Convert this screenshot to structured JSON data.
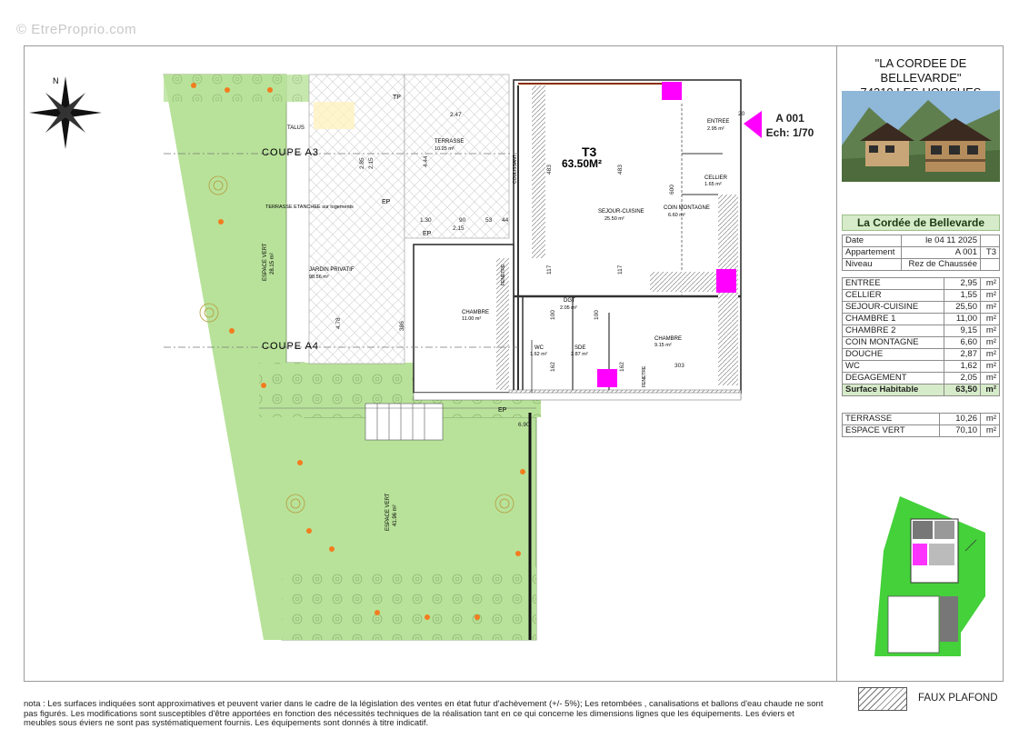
{
  "watermark": "© EtreProprio.com",
  "project": {
    "name": "\"LA CORDEE DE BELLEVARDE\"",
    "address": "74310 LES HOUCHES"
  },
  "residence_title": "La Cordée de Bellevarde",
  "unit": {
    "ref": "A 001",
    "scale": "Ech: 1/70"
  },
  "info": [
    {
      "label": "Date",
      "value": "le 04 11 2025",
      "extra": ""
    },
    {
      "label": "Appartement",
      "value": "A 001",
      "extra": "T3"
    },
    {
      "label": "Niveau",
      "value": "Rez de Chaussée",
      "extra": ""
    }
  ],
  "rooms": [
    {
      "name": "ENTREE",
      "area": "2,95",
      "unit": "m²"
    },
    {
      "name": "CELLIER",
      "area": "1,55",
      "unit": "m²"
    },
    {
      "name": "SEJOUR-CUISINE",
      "area": "25,50",
      "unit": "m²"
    },
    {
      "name": "CHAMBRE 1",
      "area": "11,00",
      "unit": "m²"
    },
    {
      "name": "CHAMBRE 2",
      "area": "9,15",
      "unit": "m²"
    },
    {
      "name": "COIN MONTAGNE",
      "area": "6,60",
      "unit": "m²"
    },
    {
      "name": "DOUCHE",
      "area": "2,87",
      "unit": "m²"
    },
    {
      "name": "WC",
      "area": "1,62",
      "unit": "m²"
    },
    {
      "name": "DEGAGEMENT",
      "area": "2,05",
      "unit": "m²"
    }
  ],
  "total": {
    "name": "Surface Habitable",
    "area": "63,50",
    "unit": "m²"
  },
  "exterior": [
    {
      "name": "TERRASSE",
      "area": "10,26",
      "unit": "m²"
    },
    {
      "name": "ESPACE VERT",
      "area": "70,10",
      "unit": "m²"
    }
  ],
  "plan": {
    "type": "T3",
    "surface": "63.50M²",
    "coupe_a3": "COUPE A3",
    "coupe_a4": "COUPE A4",
    "talus": "TALUS",
    "tp": "TP",
    "ep": "EP",
    "terrasse": "TERRASSE",
    "terrasse_area": "10.25 m²",
    "terrasse_note": "TERRASSE ETANCHEE sur logements",
    "jardin": "JARDIN PRIVATIF",
    "jardin_area": "98.56 m²",
    "espace_vert": "ESPACE VERT",
    "espace_vert_area_1": "28.15 m²",
    "espace_vert_area_2": "41.96 m²",
    "sejour": "SEJOUR-CUISINE",
    "sejour_area": "25.50 m²",
    "coin_montagne": "COIN MONTAGNE",
    "coin_montagne_area": "6.60 m²",
    "entree": "ENTREE",
    "entree_area": "2.95 m²",
    "cellier": "CELLIER",
    "cellier_area": "1.65 m²",
    "chambre1": "CHAMBRE",
    "chambre1_area": "11.00 m²",
    "chambre2": "CHAMBRE",
    "chambre2_area": "9.15 m²",
    "dgt": "DGT",
    "dgt_area": "2.05 m²",
    "wc": "WC",
    "wc_area": "1.62 m²",
    "sde": "SDE",
    "sde_area": "2.87 m²",
    "fenetre": "FENETRE",
    "coulissant": "COULISSANT",
    "dims": [
      "2.47",
      "4.44",
      "2.85",
      "2.15",
      "1.30",
      "90",
      "53",
      "44",
      "2.15",
      "483",
      "483",
      "600",
      "117",
      "117",
      "386",
      "4.78",
      "100",
      "100",
      "162",
      "162",
      "303",
      "6.90",
      "20"
    ]
  },
  "legend": {
    "label": "FAUX PLAFOND"
  },
  "note": "nota : Les surfaces indiquées sont approximatives et peuvent varier dans le cadre de la législation des ventes en état futur d'achèvement (+/- 5%); Les retombées , canalisations et ballons d'eau chaude ne sont pas figurés. Les modifications sont susceptibles d'être apportées en fonction des nécessités techniques de la réalisation tant en ce qui concerne les dimensions lignes que les équipements. Les éviers et meubles sous éviers ne sont pas systématiquement fournis. Les équipements sont donnés à titre indicatif.",
  "colors": {
    "green": "#b8e29a",
    "magenta": "#ff00ff",
    "accent_title": "#d6ebc9",
    "hatch": "#777777"
  }
}
